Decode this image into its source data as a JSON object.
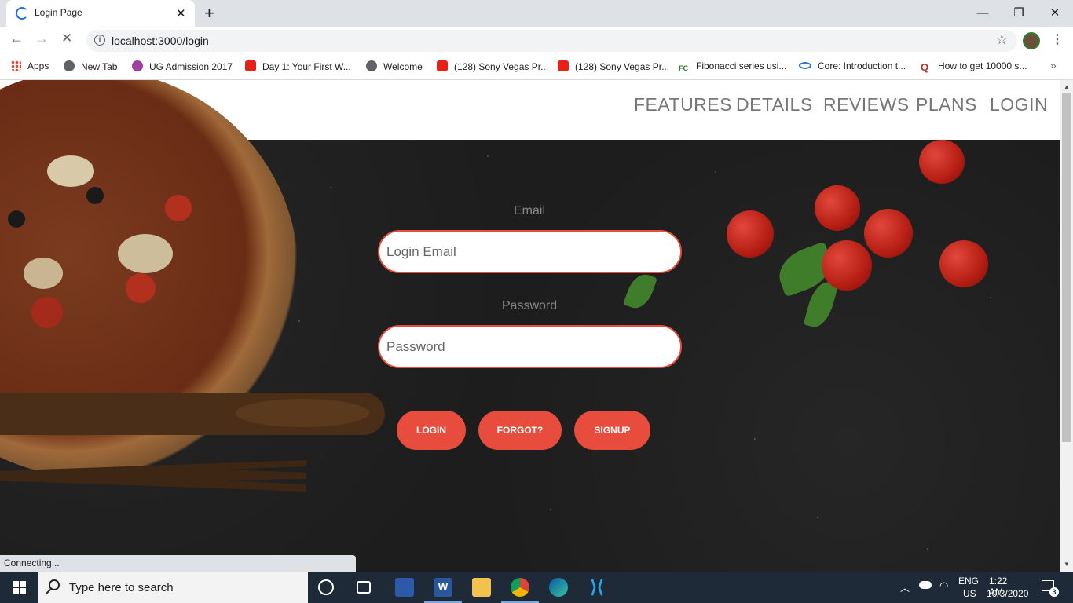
{
  "browser": {
    "tab_title": "Login Page",
    "url": "localhost:3000/login",
    "bookmarks": [
      {
        "label": "Apps",
        "icon": "apps-grid-icon"
      },
      {
        "label": "New Tab",
        "icon": "globe-icon"
      },
      {
        "label": "UG Admission 2017",
        "icon": "purple-circle-icon"
      },
      {
        "label": "Day 1: Your First W...",
        "icon": "youtube-icon"
      },
      {
        "label": "Welcome",
        "icon": "globe-icon"
      },
      {
        "label": "(128) Sony Vegas Pr...",
        "icon": "youtube-icon"
      },
      {
        "label": "(128) Sony Vegas Pr...",
        "icon": "youtube-icon"
      },
      {
        "label": "Fibonacci series usi...",
        "icon": "fc-icon"
      },
      {
        "label": "Core: Introduction t...",
        "icon": "coursera-icon"
      },
      {
        "label": "How to get 10000 s...",
        "icon": "quora-icon"
      }
    ],
    "status": "Connecting..."
  },
  "site": {
    "nav": [
      "FEATURES",
      "DETAILS",
      "REVIEWS",
      "PLANS",
      "LOGIN"
    ],
    "form": {
      "email_label": "Email",
      "email_placeholder": "Login Email",
      "password_label": "Password",
      "password_placeholder": "Password",
      "buttons": [
        "LOGIN",
        "FORGOT?",
        "SIGNUP"
      ]
    },
    "accent_color": "#e74c3c"
  },
  "taskbar": {
    "search_placeholder": "Type here to search",
    "language": "ENG",
    "region": "US",
    "time": "1:22 AM",
    "date": "10/3/2020",
    "notification_count": "3"
  }
}
